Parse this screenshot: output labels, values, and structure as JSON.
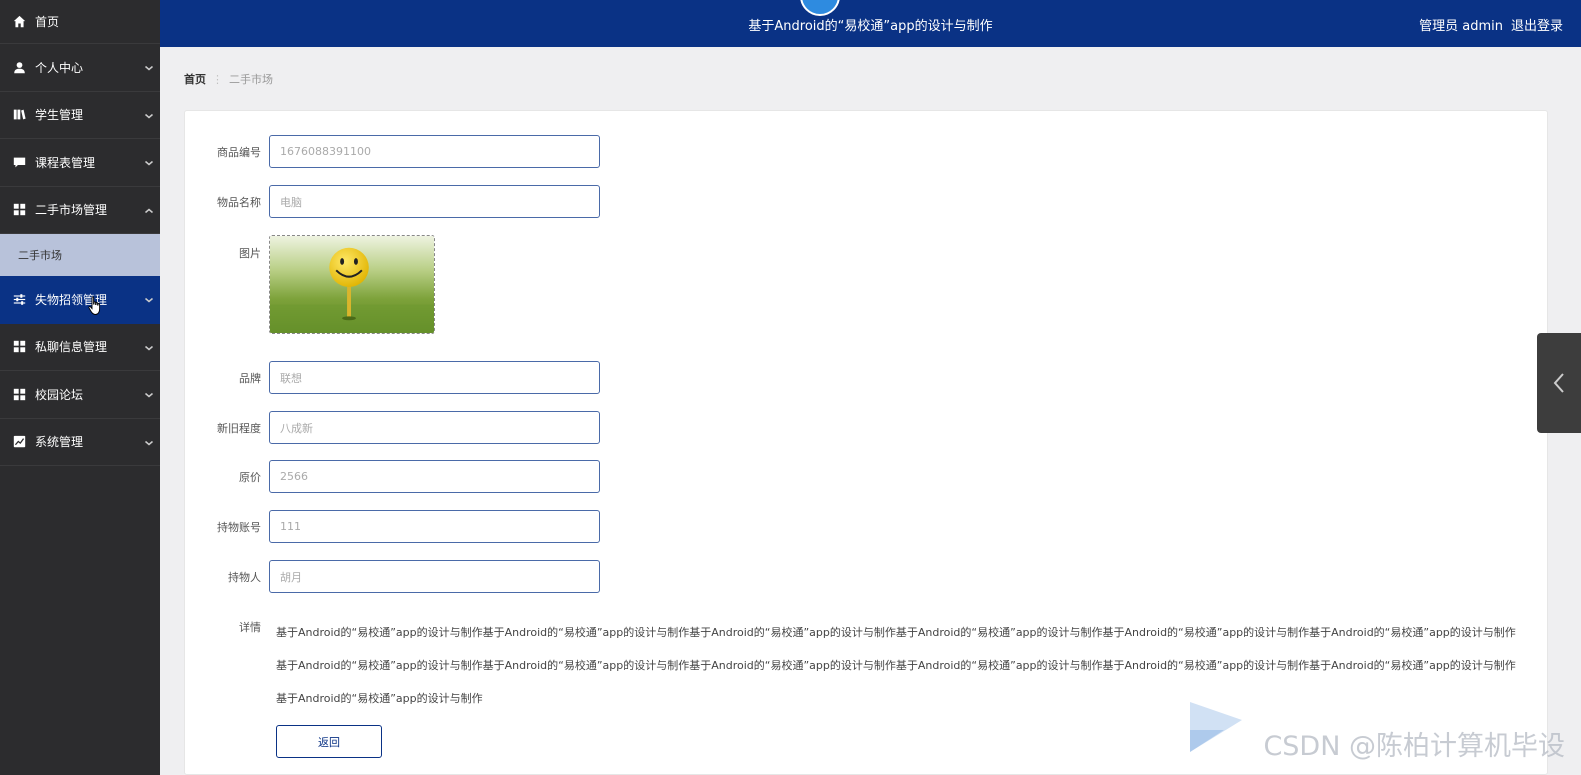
{
  "header": {
    "title": "基于Android的“易校通”app的设计与制作",
    "user_label": "管理员 admin",
    "logout_label": "退出登录"
  },
  "sidebar": {
    "items": [
      {
        "label": "首页",
        "icon": "home-icon"
      },
      {
        "label": "个人中心",
        "icon": "user-icon"
      },
      {
        "label": "学生管理",
        "icon": "book-icon"
      },
      {
        "label": "课程表管理",
        "icon": "chat-icon"
      },
      {
        "label": "二手市场管理",
        "icon": "grid-icon"
      },
      {
        "label": "失物招领管理",
        "icon": "sliders-icon"
      },
      {
        "label": "私聊信息管理",
        "icon": "grid-icon"
      },
      {
        "label": "校园论坛",
        "icon": "grid-icon"
      },
      {
        "label": "系统管理",
        "icon": "chart-icon"
      }
    ],
    "sub_item": "二手市场"
  },
  "breadcrumb": {
    "home": "首页",
    "current": "二手市场"
  },
  "form": {
    "product_no": {
      "label": "商品编号",
      "value": "1676088391100"
    },
    "item_name": {
      "label": "物品名称",
      "value": "电脑"
    },
    "image": {
      "label": "图片"
    },
    "brand": {
      "label": "品牌",
      "value": "联想"
    },
    "condition": {
      "label": "新旧程度",
      "value": "八成新"
    },
    "original_price": {
      "label": "原价",
      "value": "2566"
    },
    "owner_account": {
      "label": "持物账号",
      "value": "111"
    },
    "owner_name": {
      "label": "持物人",
      "value": "胡月"
    },
    "detail": {
      "label": "详情",
      "text": "基于Android的“易校通”app的设计与制作基于Android的“易校通”app的设计与制作基于Android的“易校通”app的设计与制作基于Android的“易校通”app的设计与制作基于Android的“易校通”app的设计与制作基于Android的“易校通”app的设计与制作基于Android的“易校通”app的设计与制作基于Android的“易校通”app的设计与制作基于Android的“易校通”app的设计与制作基于Android的“易校通”app的设计与制作基于Android的“易校通”app的设计与制作基于Android的“易校通”app的设计与制作基于Android的“易校通”app的设计与制作"
    },
    "back_label": "返回"
  },
  "watermark": "CSDN @陈柏计算机毕设",
  "colors": {
    "primary": "#0a3285",
    "sidebar_bg": "#2c2c2e",
    "sub_item_bg": "#b8c2da"
  }
}
